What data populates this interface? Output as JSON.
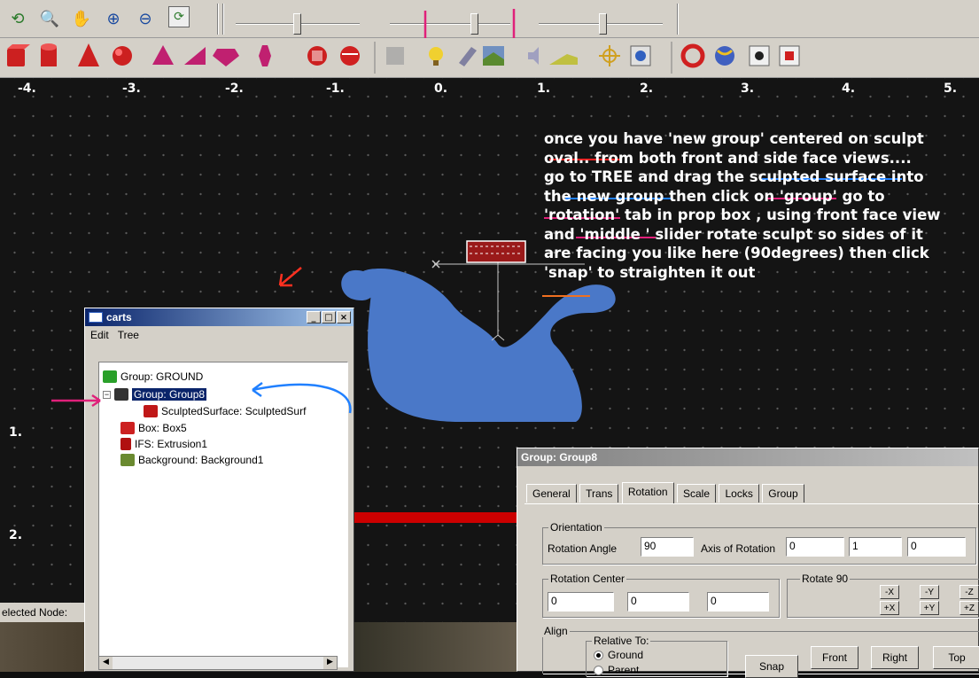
{
  "toolbar_top": {
    "icons": [
      "orbit-icon",
      "zoom-region-icon",
      "pan-hand-icon",
      "zoom-in-icon",
      "zoom-out-icon",
      "fit-view-icon"
    ],
    "sliders": [
      {
        "name": "slider-1",
        "value": 0.45
      },
      {
        "name": "slider-middle",
        "value": 0.55
      },
      {
        "name": "slider-3",
        "value": 0.55
      }
    ]
  },
  "toolbar_shapes": {
    "icons": [
      "box-icon",
      "cylinder-icon",
      "cone-icon",
      "sphere-icon",
      "pyramid-icon",
      "wedge-icon",
      "gem-icon",
      "vase-icon",
      "extrusion-icon",
      "sculpted-surface-icon",
      "group-icon",
      "point-light-icon",
      "spot-light-icon",
      "background-icon",
      "sound-icon",
      "terrain-icon",
      "directional-light-icon",
      "viewpoint-icon",
      "animation-icon",
      "world-icon",
      "inline-icon",
      "texture-icon"
    ]
  },
  "viewport": {
    "x_axis_labels": [
      "-4.",
      "-3.",
      "-2.",
      "-1.",
      "0.",
      "1.",
      "2.",
      "3.",
      "4.",
      "5."
    ],
    "y_axis_labels": [
      "1.",
      "2."
    ],
    "accent_red": "#cc0000",
    "sculpt_color": "#4a78c8"
  },
  "instructions": {
    "lines": [
      "once you have 'new group' centered on sculpt",
      "oval.. from both front and side face views....",
      "go to TREE and drag the sculpted surface into",
      "the new group then click on 'group' go to",
      "'rotation' tab in prop box , using front face view",
      "and 'middle ' slider rotate sculpt so sides of it",
      "are facing you like here (90degrees) then click",
      "'snap' to straighten it out"
    ]
  },
  "carts_window": {
    "title": "carts",
    "menu": [
      "Edit",
      "Tree"
    ],
    "nodes": [
      {
        "label": "Group:  GROUND",
        "color": "#2aa02a"
      },
      {
        "label": "Group:  Group8",
        "color": "#333333"
      },
      {
        "label": "SculptedSurface:  SculptedSurf",
        "color": "#c01818"
      },
      {
        "label": "Box:  Box5",
        "color": "#cc2020"
      },
      {
        "label": "IFS:  Extrusion1",
        "color": "#b01010"
      },
      {
        "label": "Background:  Background1",
        "color": "#6a8a30"
      }
    ]
  },
  "props_window": {
    "title": "Group:  Group8",
    "tabs": [
      "General",
      "Trans",
      "Rotation",
      "Scale",
      "Locks",
      "Group"
    ],
    "active_tab": "Rotation",
    "orientation_label": "Orientation",
    "rotation_angle_label": "Rotation Angle",
    "rotation_angle": "90",
    "axis_label": "Axis of Rotation",
    "axis": [
      "0",
      "1",
      "0"
    ],
    "center_label": "Rotation Center",
    "center": [
      "0",
      "0",
      "0"
    ],
    "rotate90_label": "Rotate 90",
    "rotate_buttons": [
      "-X",
      "-Y",
      "-Z",
      "+X",
      "+Y",
      "+Z"
    ],
    "align_label": "Align",
    "relative_to_label": "Relative To:",
    "relative_options": [
      "Ground",
      "Parent"
    ],
    "snap_label": "Snap",
    "view_buttons": [
      "Front",
      "Right",
      "Top"
    ]
  },
  "status": {
    "selected_node_label": "elected Node:"
  }
}
